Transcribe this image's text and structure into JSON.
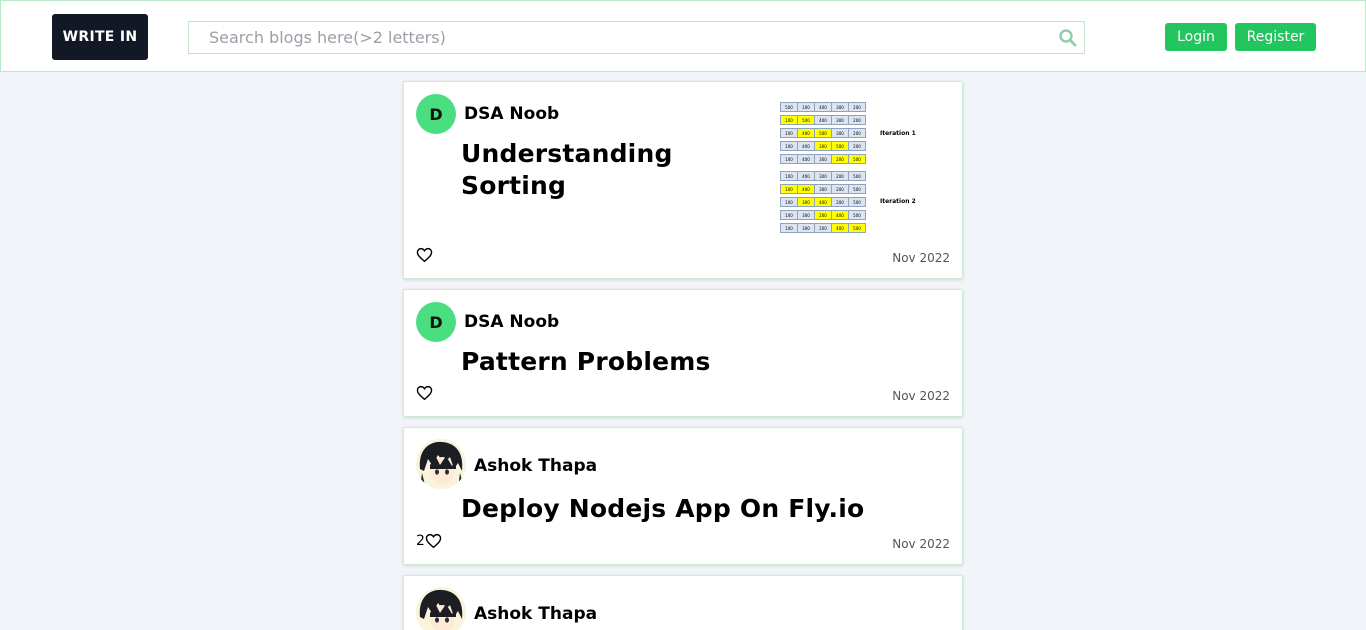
{
  "header": {
    "logo": "WRITE IN",
    "search_placeholder": "Search blogs here(>2 letters)",
    "login_label": "Login",
    "register_label": "Register"
  },
  "posts": [
    {
      "avatar_letter": "D",
      "author": "DSA Noob",
      "title": "Understanding Sorting",
      "likes": "",
      "date": "Nov 2022",
      "thumbnail": {
        "iteration_1_label": "Iteration 1",
        "iteration_2_label": "Iteration 2",
        "rows": [
          [
            "500",
            "100",
            "400",
            "300",
            "200"
          ],
          [
            "100",
            "500",
            "400",
            "300",
            "200"
          ],
          [
            "100",
            "400",
            "500",
            "300",
            "200"
          ],
          [
            "100",
            "400",
            "300",
            "500",
            "200"
          ],
          [
            "100",
            "400",
            "300",
            "200",
            "500"
          ],
          [
            "100",
            "400",
            "300",
            "200",
            "500"
          ],
          [
            "100",
            "400",
            "300",
            "200",
            "500"
          ],
          [
            "100",
            "300",
            "400",
            "200",
            "500"
          ],
          [
            "100",
            "300",
            "200",
            "400",
            "500"
          ],
          [
            "100",
            "300",
            "200",
            "400",
            "500"
          ]
        ]
      }
    },
    {
      "avatar_letter": "D",
      "author": "DSA Noob",
      "title": "Pattern Problems",
      "likes": "",
      "date": "Nov 2022"
    },
    {
      "author": "Ashok Thapa",
      "title": "Deploy Nodejs App On Fly.io",
      "likes": "2",
      "date": "Nov 2022"
    },
    {
      "author": "Ashok Thapa"
    }
  ]
}
